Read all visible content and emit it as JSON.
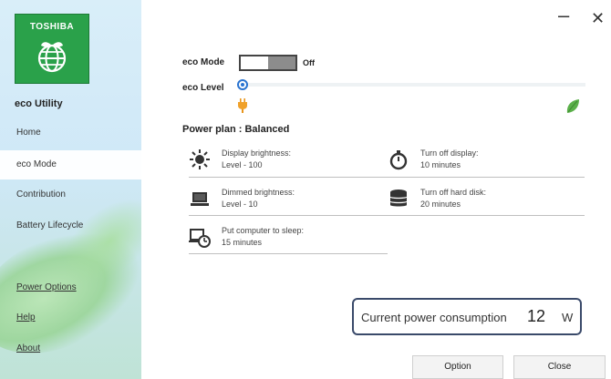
{
  "window": {
    "minimize_icon": "minimize-icon",
    "close_icon": "close-icon"
  },
  "sidebar": {
    "brand": "TOSHIBA",
    "app_title": "eco Utility",
    "nav": [
      {
        "label": "Home"
      },
      {
        "label": "eco Mode",
        "active": true
      },
      {
        "label": "Contribution"
      },
      {
        "label": "Battery Lifecycle"
      }
    ],
    "links": [
      {
        "label": "Power Options"
      },
      {
        "label": "Help"
      },
      {
        "label": "About"
      }
    ]
  },
  "eco_mode": {
    "label": "eco Mode",
    "state_text": "Off"
  },
  "eco_level": {
    "label": "eco Level"
  },
  "power_plan": {
    "title": "Power plan : Balanced",
    "settings": [
      {
        "icon": "sun-icon",
        "label": "Display brightness:",
        "value": "Level - 100"
      },
      {
        "icon": "timer-icon",
        "label": "Turn off display:",
        "value": "10 minutes"
      },
      {
        "icon": "laptop-icon",
        "label": "Dimmed brightness:",
        "value": "Level - 10"
      },
      {
        "icon": "harddisk-icon",
        "label": "Turn off hard disk:",
        "value": "20 minutes"
      },
      {
        "icon": "sleep-icon",
        "label": "Put computer to sleep:",
        "value": "15 minutes"
      }
    ]
  },
  "consumption": {
    "label": "Current power consumption",
    "value": "12",
    "unit": "W"
  },
  "buttons": {
    "option": "Option",
    "close": "Close"
  },
  "colors": {
    "accent": "#2a74d0",
    "brand_green": "#2aa14a",
    "border": "#3a4a6a"
  }
}
